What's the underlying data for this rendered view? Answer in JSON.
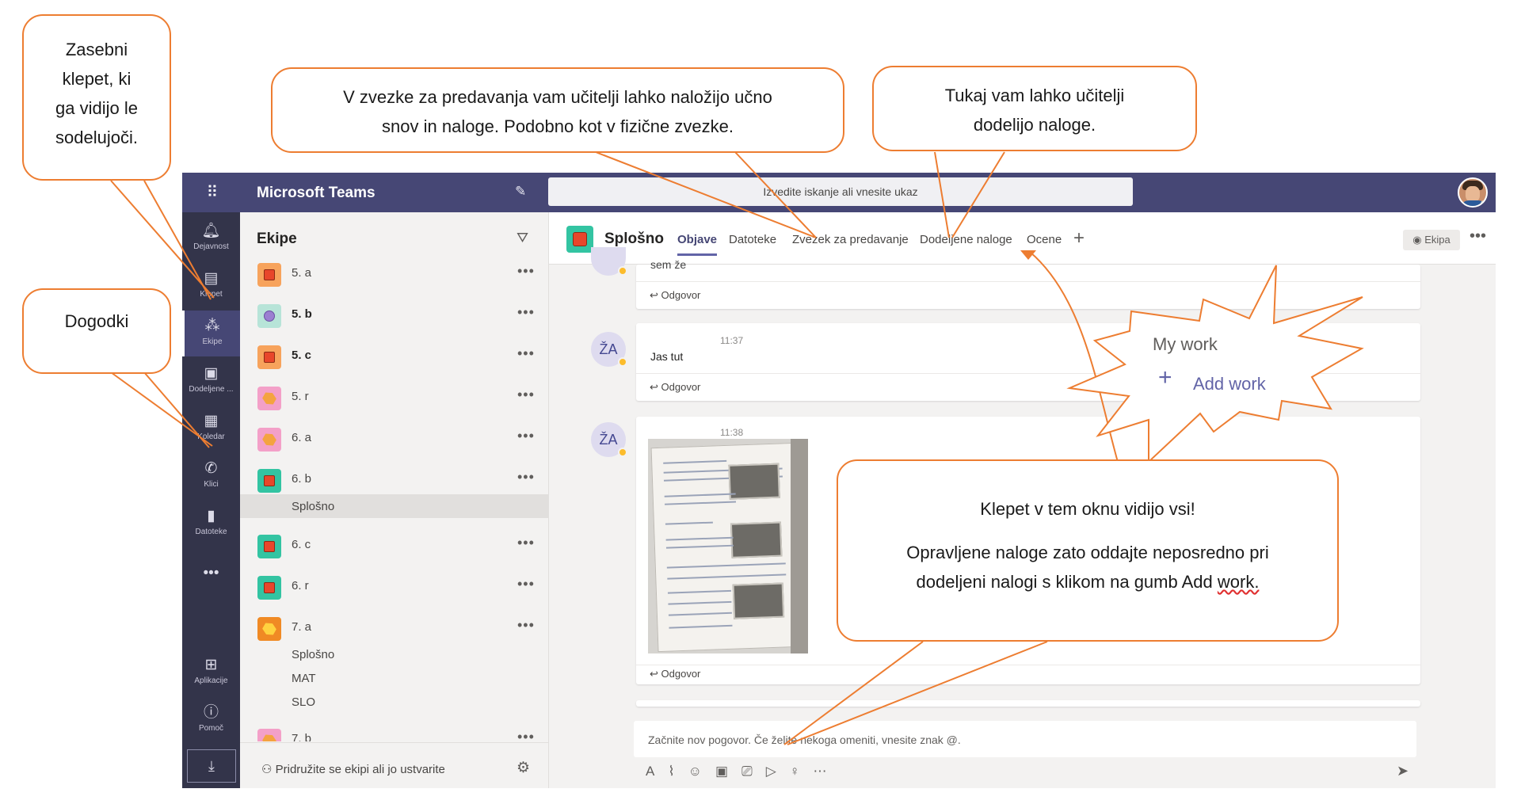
{
  "app": {
    "title": "Microsoft Teams",
    "search_placeholder": "Izvedite iskanje ali vnesite ukaz"
  },
  "rail": {
    "items": [
      {
        "label": "Dejavnost",
        "icon": "bell-icon"
      },
      {
        "label": "Klepet",
        "icon": "chat-icon"
      },
      {
        "label": "Ekipe",
        "icon": "teams-icon"
      },
      {
        "label": "Dodeljene ...",
        "icon": "assignments-icon"
      },
      {
        "label": "Koledar",
        "icon": "calendar-icon"
      },
      {
        "label": "Klici",
        "icon": "phone-icon"
      },
      {
        "label": "Datoteke",
        "icon": "file-icon"
      },
      {
        "label": "Aplikacije",
        "icon": "apps-icon"
      },
      {
        "label": "Pomoč",
        "icon": "help-icon"
      }
    ],
    "more": "•••"
  },
  "teams_panel": {
    "title": "Ekipe",
    "teams": [
      {
        "name": "5. a",
        "bold": false
      },
      {
        "name": "5. b",
        "bold": true
      },
      {
        "name": "5. c",
        "bold": true
      },
      {
        "name": "5. r",
        "bold": false
      },
      {
        "name": "6. a",
        "bold": false
      },
      {
        "name": "6. b",
        "bold": false
      },
      {
        "name": "6. c",
        "bold": false
      },
      {
        "name": "6. r",
        "bold": false
      },
      {
        "name": "7. a",
        "bold": false
      },
      {
        "name": "7. b",
        "bold": false
      }
    ],
    "channels_6b": [
      "Splošno"
    ],
    "channels_7a": [
      "Splošno",
      "MAT",
      "SLO"
    ],
    "more": "•••",
    "join_label": "Pridružite se ekipi ali jo ustvarite"
  },
  "channel": {
    "name": "Splošno",
    "tabs": [
      "Objave",
      "Datoteke",
      "Zvezek za predavanje",
      "Dodeljene naloge",
      "Ocene"
    ],
    "active_tab": "Objave",
    "team_button": "Ekipa",
    "messages": [
      {
        "snippet": "sem že",
        "reply": "Odgovor"
      },
      {
        "avatar": "ŽA",
        "time": "11:37",
        "text": "Jas tut",
        "reply": "Odgovor"
      },
      {
        "avatar": "ŽA",
        "time": "11:38",
        "text": "",
        "reply": "Odgovor",
        "has_image": true
      }
    ],
    "compose_placeholder": "Začnite nov pogovor. Če želite nekoga omeniti, vnesite znak @."
  },
  "my_work": {
    "title": "My work",
    "add_label": "Add work"
  },
  "callouts": {
    "private_chat": [
      "Zasebni",
      "klepet, ki",
      "ga vidijo le",
      "sodelujoči."
    ],
    "events": "Dogodki",
    "notebook": [
      "V zvezke za predavanja vam učitelji lahko naložijo učno",
      "snov in naloge. Podobno kot v fizične zvezke."
    ],
    "assignments": [
      "Tukaj vam lahko učitelji",
      "dodelijo naloge."
    ],
    "everyone_line1": "Klepet v tem oknu vidijo vsi!",
    "everyone_line2": "Opravljene naloge zato oddajte neposredno pri",
    "everyone_line3_pre": "dodeljeni nalogi s klikom na gumb Add ",
    "everyone_line3_word": "work."
  },
  "colors": {
    "brand": "#464775",
    "rail": "#33344a",
    "accent": "#6264a7",
    "callout_border": "#ed7d31"
  }
}
